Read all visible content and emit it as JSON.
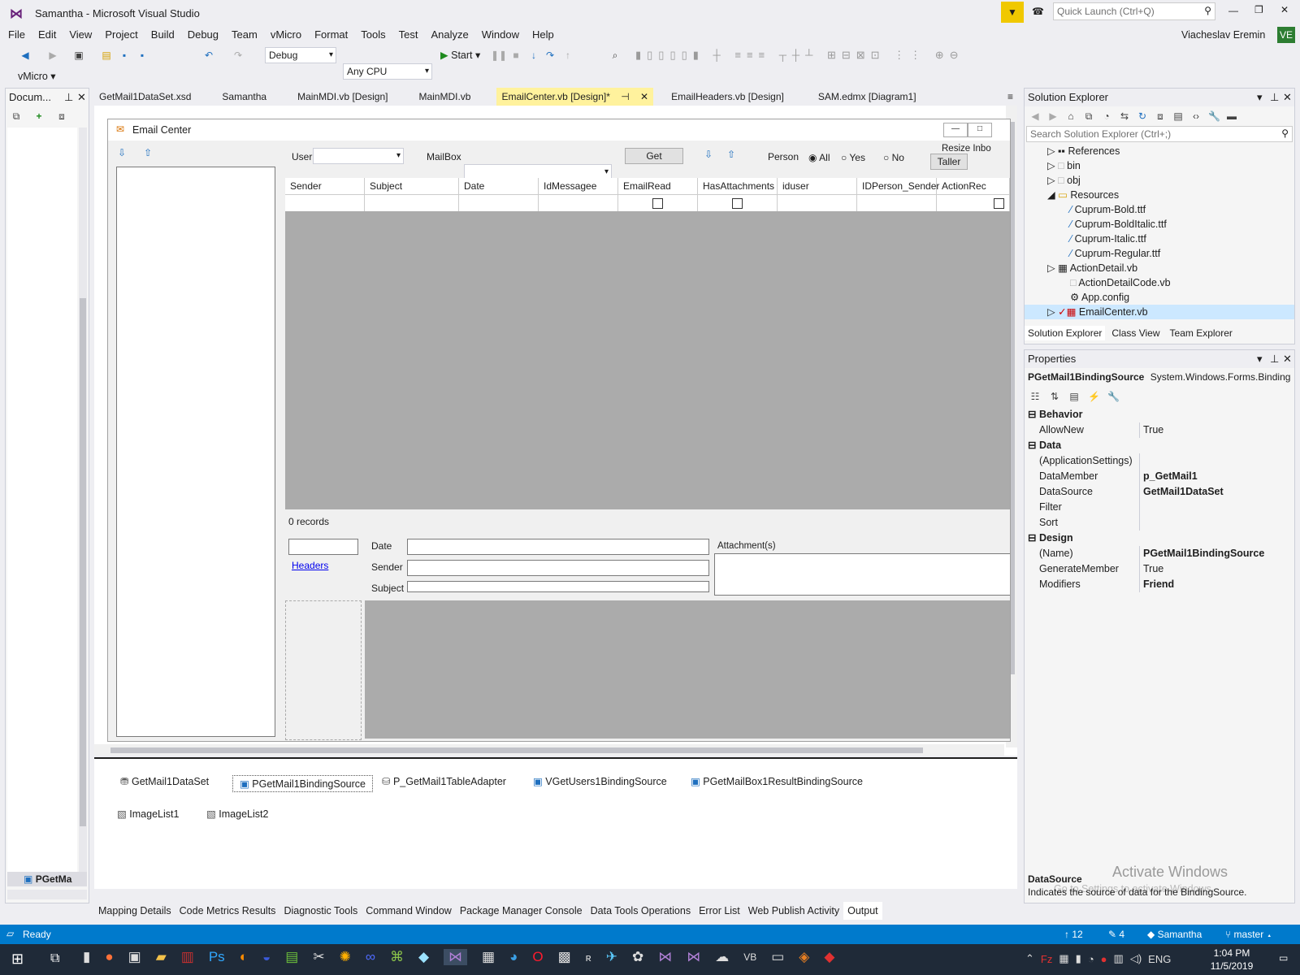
{
  "window": {
    "title": "Samantha - Microsoft Visual Studio",
    "quick_launch_placeholder": "Quick Launch (Ctrl+Q)",
    "user": "Viacheslav Eremin",
    "user_initials": "VE"
  },
  "menu": [
    "File",
    "Edit",
    "View",
    "Project",
    "Build",
    "Debug",
    "Team",
    "vMicro",
    "Format",
    "Tools",
    "Test",
    "Analyze",
    "Window",
    "Help"
  ],
  "toolbar": {
    "config": "Debug",
    "platform": "Any CPU",
    "start": "Start",
    "vmicro": "vMicro"
  },
  "doc_outline": {
    "title": "Docum...",
    "bottom_item": "PGetMa"
  },
  "tabs": [
    {
      "label": "GetMail1DataSet.xsd",
      "active": false
    },
    {
      "label": "Samantha",
      "active": false
    },
    {
      "label": "MainMDI.vb [Design]",
      "active": false
    },
    {
      "label": "MainMDI.vb",
      "active": false
    },
    {
      "label": "EmailCenter.vb [Design]*",
      "active": true
    },
    {
      "label": "EmailHeaders.vb [Design]",
      "active": false
    },
    {
      "label": "SAM.edmx [Diagram1]",
      "active": false
    }
  ],
  "form": {
    "title": "Email Center",
    "user_label": "User",
    "mailbox_label": "MailBox",
    "get_button": "Get",
    "person_label": "Person",
    "radios": [
      "All",
      "Yes",
      "No"
    ],
    "resize_label": "Resize Inbo",
    "taller_button": "Taller",
    "columns": [
      "Sender",
      "Subject",
      "Date",
      "IdMessagee",
      "EmailRead",
      "HasAttachments",
      "iduser",
      "IDPerson_Sender",
      "ActionRec"
    ],
    "records": "0 records",
    "headers_link": "Headers",
    "detail_labels": [
      "Date",
      "Sender",
      "Subject"
    ],
    "attachments_label": "Attachment(s)"
  },
  "tray": {
    "items": [
      "GetMail1DataSet",
      "PGetMail1BindingSource",
      "P_GetMail1TableAdapter",
      "VGetUsers1BindingSource",
      "PGetMailBox1ResultBindingSource",
      "ImageList1",
      "ImageList2"
    ]
  },
  "bottom_tabs": [
    "Mapping Details",
    "Code Metrics Results",
    "Diagnostic Tools",
    "Command Window",
    "Package Manager Console",
    "Data Tools Operations",
    "Error List",
    "Web Publish Activity",
    "Output"
  ],
  "solution_explorer": {
    "title": "Solution Explorer",
    "search_placeholder": "Search Solution Explorer (Ctrl+;)",
    "items": [
      "References",
      "bin",
      "obj",
      "Resources",
      "Cuprum-Bold.ttf",
      "Cuprum-BoldItalic.ttf",
      "Cuprum-Italic.ttf",
      "Cuprum-Regular.ttf",
      "ActionDetail.vb",
      "ActionDetailCode.vb",
      "App.config",
      "EmailCenter.vb"
    ],
    "tabs": [
      "Solution Explorer",
      "Class View",
      "Team Explorer"
    ]
  },
  "properties": {
    "title": "Properties",
    "object_name": "PGetMail1BindingSource",
    "object_type": "System.Windows.Forms.Binding",
    "cat_behavior": "Behavior",
    "cat_data": "Data",
    "cat_design": "Design",
    "rows": [
      {
        "name": "AllowNew",
        "value": "True"
      },
      {
        "name": "(ApplicationSettings)",
        "value": ""
      },
      {
        "name": "DataMember",
        "value": "p_GetMail1"
      },
      {
        "name": "DataSource",
        "value": "GetMail1DataSet"
      },
      {
        "name": "Filter",
        "value": ""
      },
      {
        "name": "Sort",
        "value": ""
      },
      {
        "name": "(Name)",
        "value": "PGetMail1BindingSource"
      },
      {
        "name": "GenerateMember",
        "value": "True"
      },
      {
        "name": "Modifiers",
        "value": "Friend"
      }
    ],
    "desc_title": "DataSource",
    "desc_text": "Indicates the source of data for the BindingSource.",
    "watermark": "Activate Windows",
    "watermark_sub": "Go to Settings to activate Windows."
  },
  "status": {
    "text": "Ready",
    "up_count": "12",
    "edit_count": "4",
    "project": "Samantha",
    "branch": "master"
  },
  "taskbar": {
    "lang": "ENG",
    "time": "1:04 PM",
    "date": "11/5/2019"
  }
}
